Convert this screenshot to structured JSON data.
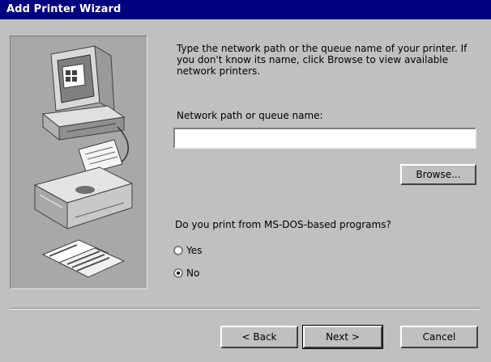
{
  "window": {
    "title": "Add Printer Wizard"
  },
  "instructions": "Type the network path or the queue name of your printer. If you don't know its name, click Browse to view available network printers.",
  "path": {
    "label": "Network path or queue name:",
    "value": ""
  },
  "browse_label": "Browse...",
  "msdos": {
    "question": "Do you print from MS-DOS-based programs?",
    "options": [
      {
        "label": "Yes",
        "selected": false
      },
      {
        "label": "No",
        "selected": true
      }
    ]
  },
  "buttons": {
    "back": "< Back",
    "next": "Next >",
    "cancel": "Cancel"
  }
}
